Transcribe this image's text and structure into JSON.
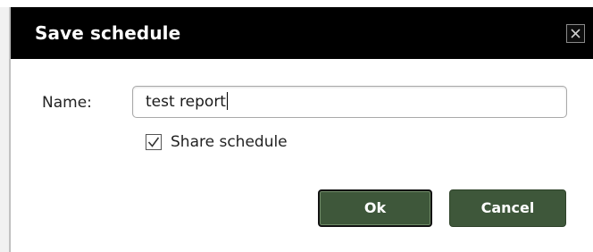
{
  "dialog": {
    "title": "Save schedule",
    "close_icon": "close-x-icon"
  },
  "form": {
    "name_label": "Name:",
    "name_value": "test report",
    "share_label": "Share schedule",
    "share_checked": true
  },
  "buttons": {
    "ok_label": "Ok",
    "cancel_label": "Cancel"
  },
  "colors": {
    "titlebar": "#000000",
    "button_bg": "#3e573a",
    "button_text": "#ffffff"
  }
}
